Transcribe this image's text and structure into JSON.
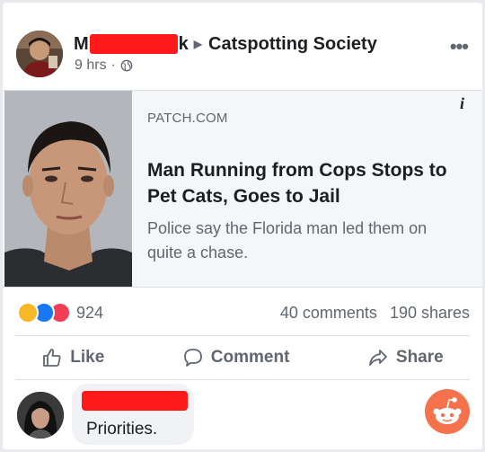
{
  "post": {
    "author_start": "M",
    "author_end": "k",
    "group": "Catspotting Society",
    "time": "9 hrs",
    "separator": "·"
  },
  "link": {
    "domain": "PATCH.COM",
    "headline": "Man Running from Cops Stops to Pet Cats, Goes to Jail",
    "description": "Police say the Florida man led them on quite a chase."
  },
  "stats": {
    "reaction_count": "924",
    "comments": "40 comments",
    "shares": "190 shares"
  },
  "actions": {
    "like": "Like",
    "comment": "Comment",
    "share": "Share"
  },
  "comment": {
    "text": "Priorities."
  },
  "colors": {
    "redaction": "#ff1a1a",
    "reddit": "#f4734d",
    "like_blue": "#1877f2"
  }
}
